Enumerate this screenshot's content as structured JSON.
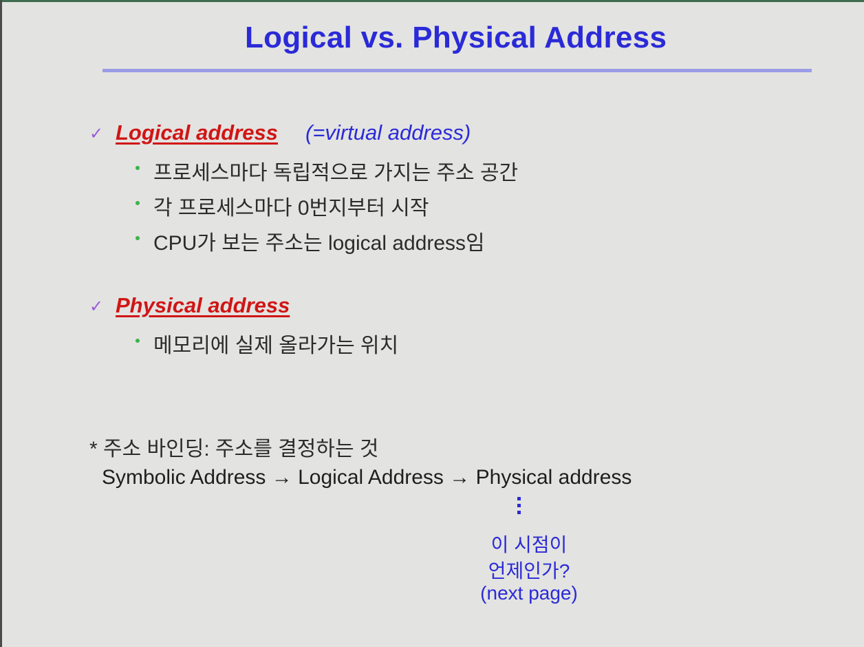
{
  "title": "Logical vs. Physical Address",
  "colors": {
    "title": "#2a2ad8",
    "heading_red": "#d01515",
    "accent_blue": "#2a2ad8",
    "bullet": "#39b34a",
    "check": "#9a5bd6",
    "rule": "#9a9de6",
    "background": "#e3e3e1"
  },
  "sections": [
    {
      "icon": "checkmark-icon",
      "check": "✓",
      "heading": "Logical address",
      "heading_suffix": "(=virtual address)",
      "bullets": [
        "프로세스마다 독립적으로 가지는 주소 공간",
        "각 프로세스마다 0번지부터 시작",
        "CPU가 보는 주소는 logical address임"
      ]
    },
    {
      "icon": "checkmark-icon",
      "check": "✓",
      "heading": "Physical address",
      "bullets": [
        "메모리에 실제 올라가는 위치"
      ]
    }
  ],
  "binding_note": "* 주소 바인딩: 주소를 결정하는 것",
  "chain": {
    "symbolic": "Symbolic Address",
    "logical": "Logical Address",
    "physical": "Physical address",
    "arrow": "→"
  },
  "callout": {
    "line1": "이 시점이",
    "line2": "언제인가?",
    "line3": "(next page)"
  }
}
